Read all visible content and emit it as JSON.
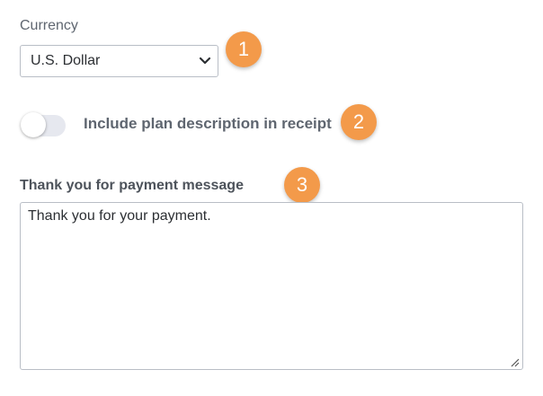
{
  "currency": {
    "label": "Currency",
    "selected": "U.S. Dollar"
  },
  "receipt_toggle": {
    "label": "Include plan description in receipt",
    "checked": false
  },
  "thank_you": {
    "label": "Thank you for payment message",
    "value": "Thank you for your payment."
  },
  "badges": [
    "1",
    "2",
    "3"
  ],
  "colors": {
    "badge": "#f39a4a",
    "label_text": "#5f6670",
    "border": "#b9bec6",
    "toggle_track": "#e6e8ef"
  }
}
